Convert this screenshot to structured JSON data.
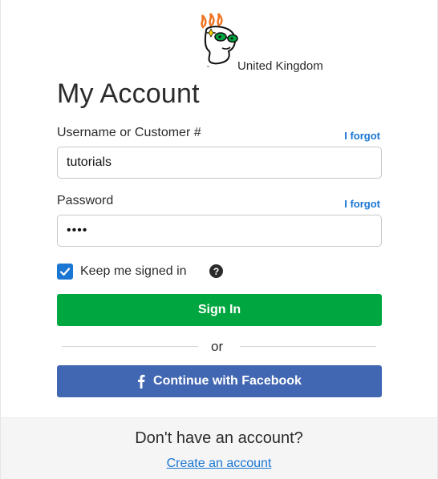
{
  "header": {
    "logo_icon": "godaddy-guy-logo-icon",
    "region": "United Kingdom",
    "title": "My Account"
  },
  "form": {
    "username_label": "Username or Customer #",
    "username_forgot": "I forgot",
    "username_value": "tutorials",
    "password_label": "Password",
    "password_forgot": "I forgot",
    "password_value": "••••",
    "keep_signed_in_label": "Keep me signed in",
    "keep_signed_in_checked": true,
    "help_icon": "question-circle-icon",
    "sign_in_button": "Sign In",
    "or_separator": "or",
    "facebook_button": "Continue with Facebook",
    "facebook_icon": "facebook-f-icon"
  },
  "footer": {
    "prompt": "Don't have an account?",
    "create_link": "Create an account"
  },
  "colors": {
    "primary_green": "#00a63f",
    "facebook_blue": "#4267b2",
    "link_blue": "#1976d2",
    "text_dark": "#2b2b2b",
    "footer_bg": "#f5f5f6"
  }
}
